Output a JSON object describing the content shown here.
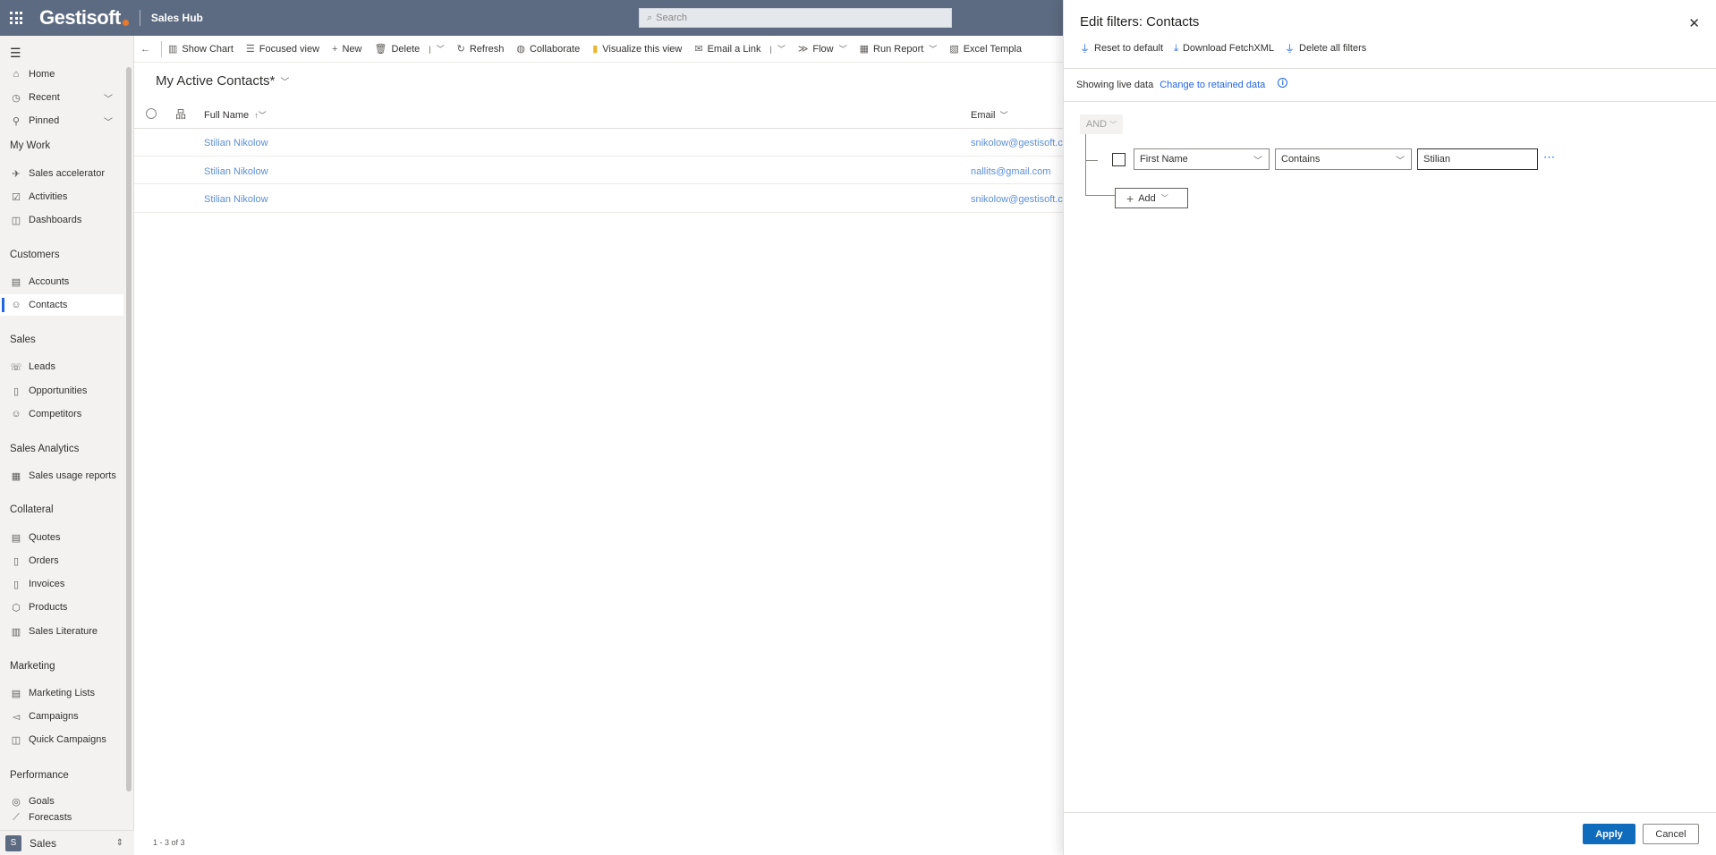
{
  "topbar": {
    "brand": "Gestisoft",
    "app_title": "Sales Hub",
    "search_placeholder": "Search"
  },
  "nav": {
    "items_top": [
      {
        "label": "Home",
        "icon": "home-icon"
      },
      {
        "label": "Recent",
        "icon": "clock-icon"
      },
      {
        "label": "Pinned",
        "icon": "pin-icon"
      }
    ],
    "groups": {
      "my_work": "My Work",
      "customers": "Customers",
      "sales": "Sales",
      "sales_analytics": "Sales Analytics",
      "collateral": "Collateral",
      "marketing": "Marketing",
      "performance": "Performance"
    },
    "my_work": [
      "Sales accelerator",
      "Activities",
      "Dashboards"
    ],
    "customers": [
      "Accounts",
      "Contacts"
    ],
    "sales": [
      "Leads",
      "Opportunities",
      "Competitors"
    ],
    "sales_analytics": [
      "Sales usage reports"
    ],
    "collateral": [
      "Quotes",
      "Orders",
      "Invoices",
      "Products",
      "Sales Literature"
    ],
    "marketing": [
      "Marketing Lists",
      "Campaigns",
      "Quick Campaigns"
    ],
    "performance": [
      "Goals",
      "Forecasts"
    ],
    "area": {
      "badge": "S",
      "label": "Sales"
    }
  },
  "commands": {
    "show_chart": "Show Chart",
    "focused_view": "Focused view",
    "new": "New",
    "delete": "Delete",
    "refresh": "Refresh",
    "collaborate": "Collaborate",
    "visualize": "Visualize this view",
    "email_link": "Email a Link",
    "flow": "Flow",
    "run_report": "Run Report",
    "excel_templates": "Excel Templa"
  },
  "grid": {
    "view_title": "My Active Contacts*",
    "col_fullname": "Full Name",
    "col_email": "Email",
    "rows": [
      {
        "name": "Stilian Nikolow",
        "email": "snikolow@gestisoft.com"
      },
      {
        "name": "Stilian Nikolow",
        "email": "nallits@gmail.com"
      },
      {
        "name": "Stilian Nikolow",
        "email": "snikolow@gestisoft.com"
      }
    ],
    "count": "1 - 3 of 3"
  },
  "panel": {
    "title": "Edit filters: Contacts",
    "reset": "Reset to default",
    "download": "Download FetchXML",
    "delete_all": "Delete all filters",
    "live_data": "Showing live data",
    "change_retained": "Change to retained data",
    "group_op": "AND",
    "condition": {
      "field": "First Name",
      "operator": "Contains",
      "value": "Stilian"
    },
    "add": "Add",
    "apply": "Apply",
    "cancel": "Cancel"
  },
  "colors": {
    "topbar": "#5d6b82",
    "accent": "#2266e3",
    "apply": "#0f6cbd",
    "brand_dot": "#e8792c"
  }
}
